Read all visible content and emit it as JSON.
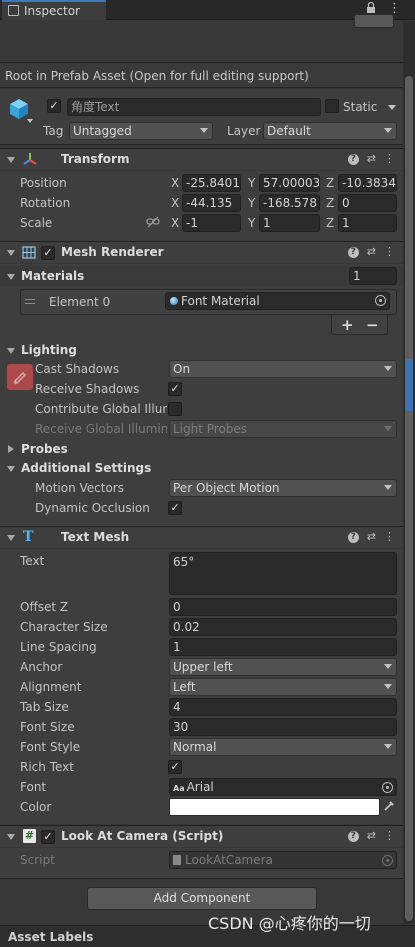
{
  "tab": {
    "label": "Inspector"
  },
  "prefab_notice": "Root in Prefab Asset (Open for full editing support)",
  "object": {
    "name": "角度Text",
    "static_label": "Static",
    "tag_label": "Tag",
    "tag_value": "Untagged",
    "layer_label": "Layer",
    "layer_value": "Default"
  },
  "transform": {
    "title": "Transform",
    "position_label": "Position",
    "rotation_label": "Rotation",
    "scale_label": "Scale",
    "axis_x": "X",
    "axis_y": "Y",
    "axis_z": "Z",
    "position": [
      "-25.8401",
      "57.00003",
      "-10.3834"
    ],
    "rotation": [
      "-44.135",
      "-168.578",
      "0"
    ],
    "scale": [
      "-1",
      "1",
      "1"
    ]
  },
  "mesh_renderer": {
    "title": "Mesh Renderer",
    "materials_label": "Materials",
    "materials_count": "1",
    "element0_label": "Element 0",
    "element0_value": "Font Material",
    "add_btn": "+",
    "remove_btn": "−",
    "lighting_label": "Lighting",
    "cast_shadows_label": "Cast Shadows",
    "cast_shadows_value": "On",
    "receive_shadows_label": "Receive Shadows",
    "contribute_gi_label": "Contribute Global Illumi",
    "receive_gi_label": "Receive Global Illumina",
    "receive_gi_value": "Light Probes",
    "probes_label": "Probes",
    "additional_label": "Additional Settings",
    "motion_vectors_label": "Motion Vectors",
    "motion_vectors_value": "Per Object Motion",
    "dynamic_occlusion_label": "Dynamic Occlusion"
  },
  "text_mesh": {
    "title": "Text Mesh",
    "text_label": "Text",
    "text_value": "65°",
    "offset_z_label": "Offset Z",
    "offset_z": "0",
    "char_size_label": "Character Size",
    "char_size": "0.02",
    "line_spacing_label": "Line Spacing",
    "line_spacing": "1",
    "anchor_label": "Anchor",
    "anchor": "Upper left",
    "alignment_label": "Alignment",
    "alignment": "Left",
    "tab_size_label": "Tab Size",
    "tab_size": "4",
    "font_size_label": "Font Size",
    "font_size": "30",
    "font_style_label": "Font Style",
    "font_style": "Normal",
    "rich_text_label": "Rich Text",
    "font_label": "Font",
    "font_prefix": "Aa",
    "font_value": "Arial",
    "color_label": "Color",
    "color_hex": "#ffffff"
  },
  "look_at_camera": {
    "title": "Look At Camera (Script)",
    "script_label": "Script",
    "script_value": "LookAtCamera"
  },
  "add_component": "Add Component",
  "asset_labels": "Asset Labels",
  "watermark": "CSDN @心疼你的一切",
  "icons": {
    "lock": "🔒",
    "menu": "⋮",
    "help": "?",
    "settings": "⇄",
    "check": "✓",
    "link": "⛓",
    "target": "⊙",
    "picker": "✎"
  }
}
